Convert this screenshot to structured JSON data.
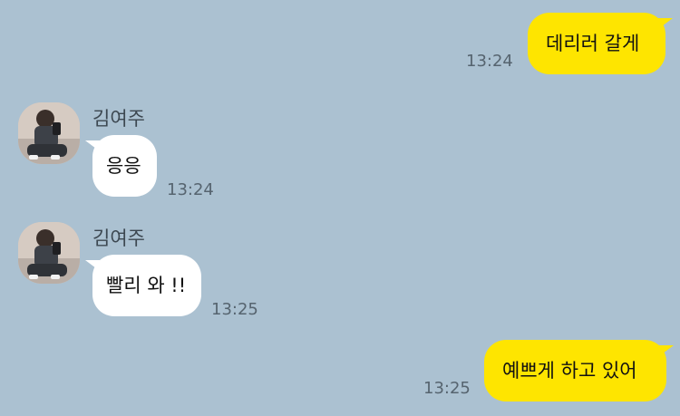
{
  "colors": {
    "background": "#abc1d1",
    "my_bubble": "#fee500",
    "their_bubble": "#ffffff",
    "time_text": "#56646f"
  },
  "messages": [
    {
      "from": "me",
      "text": "데리러 갈게",
      "time": "13:24"
    },
    {
      "from": "other",
      "sender": "김여주",
      "text": "응응",
      "time": "13:24"
    },
    {
      "from": "other",
      "sender": "김여주",
      "text": "빨리 와 !!",
      "time": "13:25"
    },
    {
      "from": "me",
      "text": "예쁘게 하고 있어",
      "time": "13:25"
    }
  ]
}
